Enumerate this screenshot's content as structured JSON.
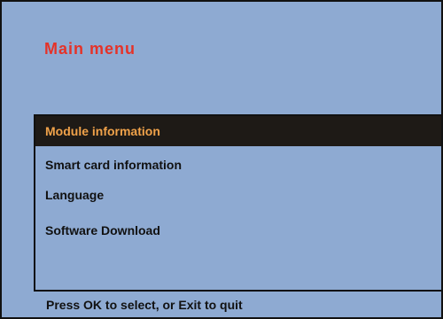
{
  "title": "Main menu",
  "menu": {
    "items": [
      {
        "label": "Module information",
        "selected": true
      },
      {
        "label": "Smart card information",
        "selected": false
      },
      {
        "label": "Language",
        "selected": false
      },
      {
        "label": "Software Download",
        "selected": false
      }
    ]
  },
  "hint": "Press OK to select, or Exit to quit",
  "colors": {
    "background": "#8eaad2",
    "title": "#e53228",
    "selected_bg": "#1e1a16",
    "selected_text": "#f0a24a",
    "text": "#111111"
  }
}
